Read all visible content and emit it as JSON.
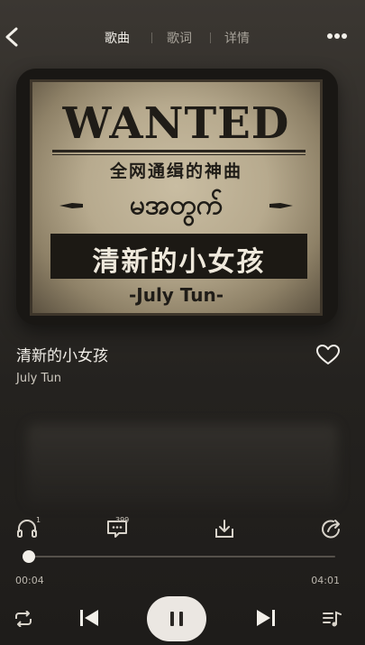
{
  "header": {
    "tabs": [
      {
        "label": "歌曲",
        "active": true
      },
      {
        "label": "歌词",
        "active": false
      },
      {
        "label": "详情",
        "active": false
      }
    ]
  },
  "cover": {
    "line1": "WANTED",
    "line2": "全网通缉的神曲",
    "line3": "မအတွက်",
    "line4": "清新的小女孩",
    "line5": "-July Tun-"
  },
  "song": {
    "title": "清新的小女孩",
    "artist": "July Tun"
  },
  "actions": {
    "listen_badge": "1",
    "comment_count": "399"
  },
  "player": {
    "current_time": "00:04",
    "total_time": "04:01",
    "progress_fraction": 0.017
  },
  "icons": [
    "back-icon",
    "more-icon",
    "heart-icon",
    "listen-together-icon",
    "comment-icon",
    "download-icon",
    "share-icon",
    "loop-icon",
    "previous-icon",
    "pause-icon",
    "next-icon",
    "playlist-icon"
  ]
}
